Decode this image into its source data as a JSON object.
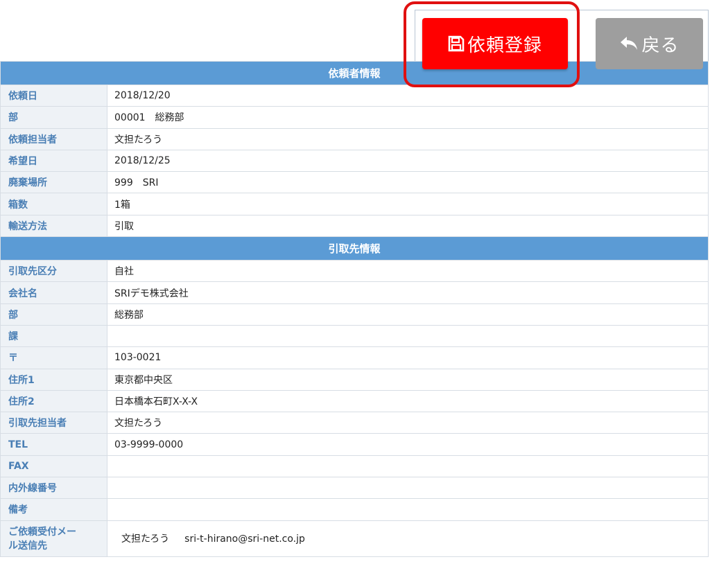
{
  "toolbar": {
    "register_label": "依頼登録",
    "back_label": "戻る",
    "register_color": "#ff0000",
    "back_color": "#9e9e9e",
    "highlight_color": "#e01010"
  },
  "requester_section": {
    "title": "依頼者情報",
    "rows": [
      {
        "label": "依頼日",
        "value": "2018/12/20"
      },
      {
        "label": "部",
        "value": "00001　総務部"
      },
      {
        "label": "依頼担当者",
        "value": "文担たろう"
      },
      {
        "label": "希望日",
        "value": "2018/12/25"
      },
      {
        "label": "廃棄場所",
        "value": "999　SRI"
      },
      {
        "label": "箱数",
        "value": "1箱"
      },
      {
        "label": "輸送方法",
        "value": "引取"
      }
    ]
  },
  "pickup_section": {
    "title": "引取先情報",
    "rows": [
      {
        "label": "引取先区分",
        "value": "自社"
      },
      {
        "label": "会社名",
        "value": "SRIデモ株式会社"
      },
      {
        "label": "部",
        "value": "総務部"
      },
      {
        "label": "課",
        "value": ""
      },
      {
        "label": "〒",
        "value": "103-0021"
      },
      {
        "label": "住所1",
        "value": "東京都中央区"
      },
      {
        "label": "住所2",
        "value": "日本橋本石町X-X-X"
      },
      {
        "label": "引取先担当者",
        "value": "文担たろう"
      },
      {
        "label": "TEL",
        "value": "03-9999-0000"
      },
      {
        "label": "FAX",
        "value": ""
      },
      {
        "label": "内外線番号",
        "value": ""
      },
      {
        "label": "備考",
        "value": ""
      }
    ],
    "mail": {
      "label_line1": "ご依頼受付メー",
      "label_line2": "ル送信先",
      "name": "文担たろう",
      "email": "sri-t-hirano@sri-net.co.jp"
    }
  }
}
